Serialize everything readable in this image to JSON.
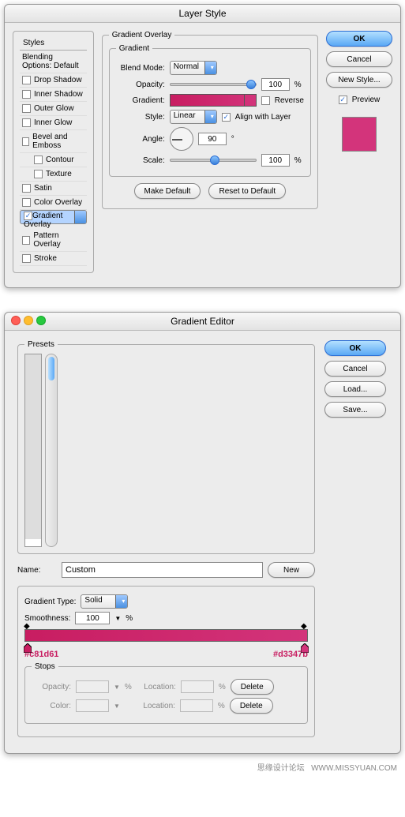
{
  "layer_style": {
    "title": "Layer Style",
    "styles_header": "Styles",
    "blending_label": "Blending Options: Default",
    "effects": [
      "Drop Shadow",
      "Inner Shadow",
      "Outer Glow",
      "Inner Glow",
      "Bevel and Emboss",
      "Contour",
      "Texture",
      "Satin",
      "Color Overlay",
      "Gradient Overlay",
      "Pattern Overlay",
      "Stroke"
    ],
    "group_outer": "Gradient Overlay",
    "group_inner": "Gradient",
    "blend_mode_l": "Blend Mode:",
    "blend_mode_v": "Normal",
    "opacity_l": "Opacity:",
    "opacity_v": "100",
    "pct": "%",
    "gradient_l": "Gradient:",
    "reverse_l": "Reverse",
    "style_l": "Style:",
    "style_v": "Linear",
    "align_l": "Align with Layer",
    "angle_l": "Angle:",
    "angle_v": "90",
    "deg": "°",
    "scale_l": "Scale:",
    "scale_v": "100",
    "make_default": "Make Default",
    "reset_default": "Reset to Default",
    "ok": "OK",
    "cancel": "Cancel",
    "new_style": "New Style...",
    "preview_l": "Preview"
  },
  "grad_editor": {
    "title": "Gradient Editor",
    "presets_l": "Presets",
    "ok": "OK",
    "cancel": "Cancel",
    "load": "Load...",
    "save": "Save...",
    "name_l": "Name:",
    "name_v": "Custom",
    "new": "New",
    "type_l": "Gradient Type:",
    "type_v": "Solid",
    "smooth_l": "Smoothness:",
    "smooth_v": "100",
    "pct": "%",
    "hex_left": "#c81d61",
    "hex_right": "#d3347b",
    "stops_l": "Stops",
    "opacity_l": "Opacity:",
    "location_l": "Location:",
    "color_l": "Color:",
    "delete": "Delete"
  },
  "footer": {
    "cn": "思缘设计论坛",
    "url": "WWW.MISSYUAN.COM"
  },
  "swatches": [
    "linear-gradient(#000,#fff)",
    "linear-gradient(#c81d61,#d3347b)",
    "repeating-conic-gradient(#ccc 0 25%,#fff 0 50%) 0/8px 8px",
    "linear-gradient(#000,#aaa)",
    "linear-gradient(90deg,red,orange,yellow,green,blue,violet)",
    "linear-gradient(#ffa500,#8b0000)",
    "linear-gradient(#8b4513,#d2b48c)",
    "linear-gradient(45deg,#000,#fff)",
    "linear-gradient(#333,#eee)",
    "linear-gradient(45deg,#000 25%,#fff 25%,#fff 50%,#000 50%) 0/10px 10px",
    "linear-gradient(#e0e0e0,#999)",
    "linear-gradient(#222,#666)",
    "linear-gradient(#ddd,#555)",
    "linear-gradient(#fff,#333)",
    "linear-gradient(#aaa,#444)",
    "linear-gradient(#bbb,#222)",
    "linear-gradient(#ccc,#111)",
    "linear-gradient(#888,#000)",
    "linear-gradient(#eee,#888)",
    "linear-gradient(#999,#333)",
    "linear-gradient(#800,#f88)",
    "linear-gradient(#a50,#fc8)",
    "linear-gradient(#880,#ff8)",
    "linear-gradient(#080,#8f8)",
    "linear-gradient(#088,#8ff)",
    "linear-gradient(#008,#88f)",
    "linear-gradient(#808,#f8f)",
    "linear-gradient(#844,#fcc)",
    "linear-gradient(#666,#ccc)",
    "linear-gradient(#333,#888)",
    "linear-gradient(#eee,#ccc)",
    "linear-gradient(#ddd,#bbb)",
    "linear-gradient(#ccc,#aaa)",
    "linear-gradient(#bbb,#999)",
    "linear-gradient(#aaa,#888)",
    "linear-gradient(#999,#777)",
    "linear-gradient(#888,#666)",
    "linear-gradient(#777,#555)",
    "linear-gradient(#fff,#aaa)",
    "linear-gradient(#fff,#888)",
    "linear-gradient(#f8c,#f00)",
    "linear-gradient(#fc8,#f80)",
    "linear-gradient(#ff8,#cc0)",
    "linear-gradient(#8f8,#0a0)",
    "linear-gradient(#8ff,#0aa)",
    "linear-gradient(#88f,#00a)",
    "linear-gradient(#c8f,#80a)",
    "linear-gradient(#fcc,#f88)",
    "linear-gradient(#eee,#999)",
    "linear-gradient(#ccc,#666)",
    "#ff1493",
    "#ff0000",
    "#ff8c00",
    "#ffd700",
    "#32cd32",
    "#00ced1",
    "#1e90ff",
    "#8a2be2",
    "#ff69b4",
    "#dc143c",
    "linear-gradient(#c0c,#f0f)",
    "linear-gradient(#f55,#fcc)",
    "linear-gradient(#f80,#fc8)",
    "linear-gradient(#cc0,#ff8)",
    "linear-gradient(#0c0,#8f8)",
    "linear-gradient(#0cc,#8ff)",
    "linear-gradient(#05f,#8cf)",
    "linear-gradient(#80c,#c8f)",
    "linear-gradient(#f0a,#f8d)",
    "linear-gradient(#ccc,#fff)",
    "linear-gradient(#9c3,#cf8)",
    "linear-gradient(#3c9,#8fc)",
    "linear-gradient(#39c,#8cf)",
    "linear-gradient(#93c,#c8f)",
    "linear-gradient(#c39,#f8c)",
    "linear-gradient(#c93,#fc8)",
    "linear-gradient(#4a4,#8d8)",
    "linear-gradient(#a44,#d88)",
    "linear-gradient(#44a,#88d)",
    "linear-gradient(#888,#eee)",
    "linear-gradient(#ffb,#8f8,#f8f)",
    "linear-gradient(#8f8,#0a0,#060)",
    "linear-gradient(#f88,#f00,#800)",
    "linear-gradient(#88f,#00f,#008)",
    "linear-gradient(#ff8,#f80,#800)",
    "linear-gradient(#f8f,#808,#404)",
    "linear-gradient(#8ff,#088,#044)",
    "linear-gradient(#fc8,#c84,#842)",
    "linear-gradient(#ccc,#888,#444)",
    "linear-gradient(#fff,#ccc,#888)"
  ]
}
